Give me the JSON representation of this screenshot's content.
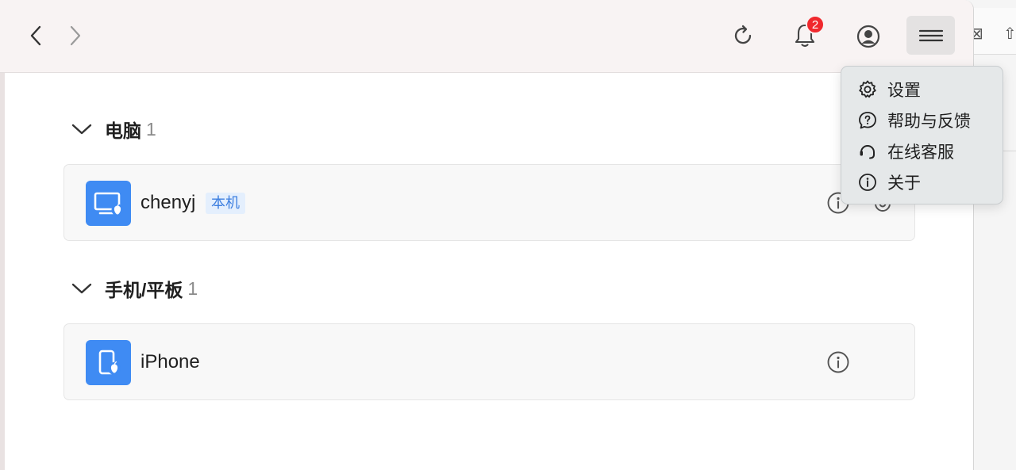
{
  "toolbar": {
    "back_icon": "chevron-left-icon",
    "forward_icon": "chevron-right-icon",
    "refresh_icon": "refresh-icon",
    "notification_icon": "bell-icon",
    "notification_count": "2",
    "account_icon": "user-circle-icon",
    "menu_icon": "hamburger-menu-icon"
  },
  "sections": [
    {
      "title": "电脑",
      "count": "1",
      "devices": [
        {
          "name": "chenyj",
          "tag": "本机",
          "icon": "mac-computer-icon"
        }
      ]
    },
    {
      "title": "手机/平板",
      "count": "1",
      "devices": [
        {
          "name": "iPhone",
          "icon": "iphone-icon"
        }
      ]
    }
  ],
  "menu": {
    "items": [
      {
        "label": "设置",
        "icon": "gear-icon"
      },
      {
        "label": "帮助与反馈",
        "icon": "help-icon"
      },
      {
        "label": "在线客服",
        "icon": "headset-icon"
      },
      {
        "label": "关于",
        "icon": "info-icon"
      }
    ]
  },
  "colors": {
    "accent": "#3f8bf3",
    "badge": "#f0282d",
    "tag_bg": "#e4effd",
    "tag_text": "#3d7fe0"
  }
}
